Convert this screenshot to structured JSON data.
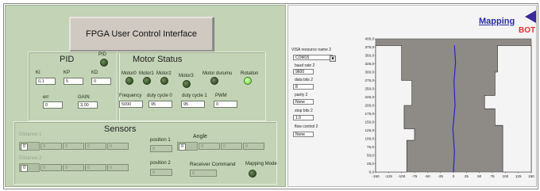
{
  "title": "FPGA User Control Interface",
  "pid": {
    "heading": "PID",
    "led_label": "PID",
    "ki_label": "KI",
    "kp_label": "KP",
    "kd_label": "KD",
    "ki": "0,1",
    "kp": "5",
    "kd": "0",
    "err_label": "err",
    "gain_label": "GAIN",
    "err": "0",
    "gain": "3,00"
  },
  "motor": {
    "heading": "Motor Status",
    "leds": [
      "Motor0",
      "Motor1",
      "Motor2",
      "Motor3",
      "Motor durumu",
      "Rotation"
    ],
    "frequency_label": "Frequency",
    "duty0_label": "duty cycle 0",
    "duty1_label": "duty cycle 1",
    "pwm_label": "PWM",
    "frequency": "5000",
    "duty0": "95",
    "duty1": "95",
    "pwm": "0"
  },
  "sensors": {
    "heading": "Sensors",
    "distance1_label": "Distance 1",
    "distance2_label": "Distance 2",
    "position1_label": "position 1",
    "position2_label": "position 2",
    "angle_label": "Angle",
    "receiver_label": "Receiver Command",
    "mapping_mode_label": "Mapping Mode",
    "index": "0",
    "cell": "0"
  },
  "visa": {
    "resource_label": "VISA resource name 2",
    "resource_value": "COM15",
    "baud_label": "baud rate 2",
    "baud_value": "9600",
    "databits_label": "data bits 2",
    "databits_value": "8",
    "parity_label": "parity 2",
    "parity_value": "None",
    "stopbits_label": "stop bits 2",
    "stopbits_value": "1.0",
    "flow_label": "flow control 2",
    "flow_value": "None"
  },
  "mapping": {
    "label": "Mapping",
    "bot_label": "BOT"
  },
  "plot": {
    "y_ticks": [
      "400,0",
      "375,0",
      "350,0",
      "325,0",
      "300,0",
      "275,0",
      "250,0",
      "225,0",
      "200,0",
      "175,0",
      "150,0",
      "125,0",
      "100,0",
      "75,0",
      "50,0",
      "25,0",
      "0,0"
    ],
    "x_ticks": [
      "-150",
      "-125",
      "-100",
      "-75",
      "-50",
      "-25",
      "0",
      "25",
      "50",
      "75",
      "100",
      "125",
      "150"
    ]
  },
  "colors": {
    "panel": "#c3d3b6",
    "plot_bg": "#8e8a86",
    "path": "#2424c8",
    "wall": "#f4f4f4"
  }
}
